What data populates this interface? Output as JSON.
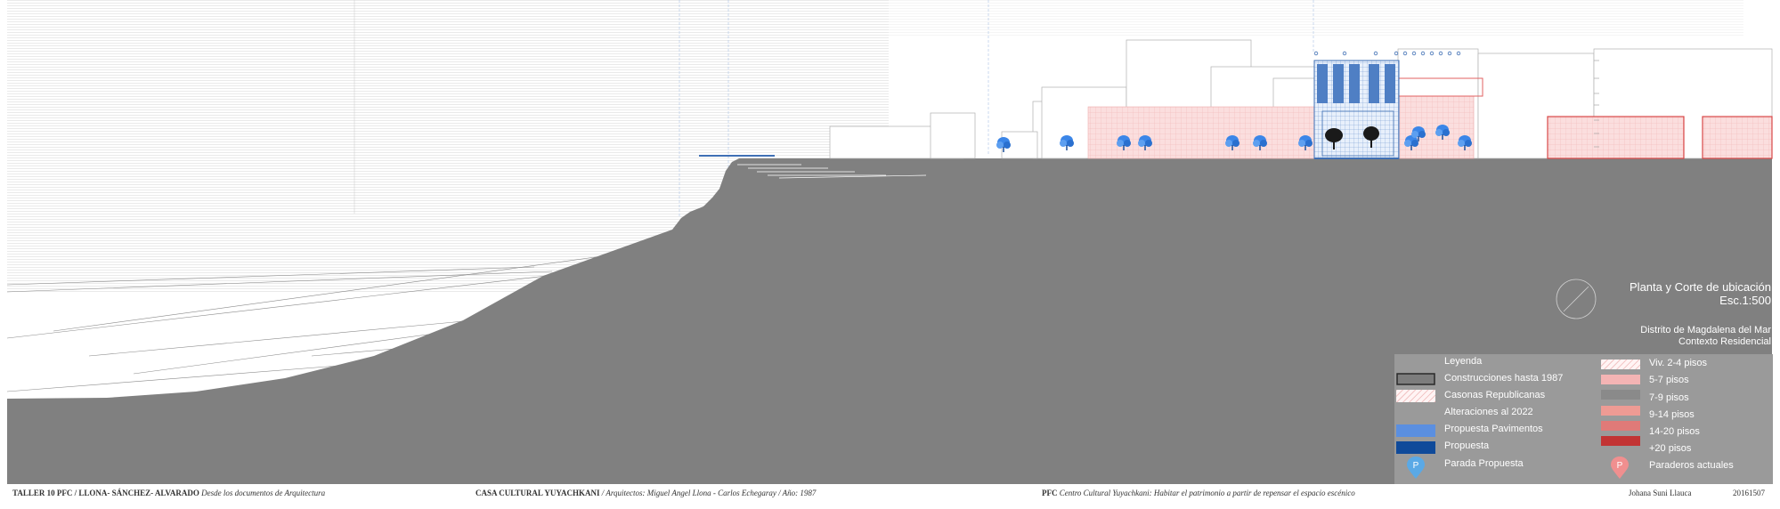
{
  "title_block": {
    "line1": "Planta y Corte de ubicación",
    "line2": "Esc.1:500",
    "line3": "Distrito de Magdalena del Mar",
    "line4": "Contexto Residencial"
  },
  "legend": {
    "heading": "Leyenda",
    "left_items": [
      {
        "label": "Construcciones hasta 1987",
        "icon": "outlined-box",
        "color": "#666666"
      },
      {
        "label": "Casonas Republicanas",
        "icon": "hatched-box",
        "color": "#f4c6c6"
      },
      {
        "label": "Alteraciones al 2022",
        "icon": "none",
        "color": ""
      },
      {
        "label": "Propuesta Pavimentos",
        "icon": "filled-box",
        "color": "#5b8fe0"
      },
      {
        "label": "Propuesta",
        "icon": "filled-box",
        "color": "#0f4a9a"
      },
      {
        "label": "Parada Propuesta",
        "icon": "parking-pin",
        "color": "#5aa9e6"
      }
    ],
    "right_items": [
      {
        "label": "Viv. 2-4 pisos",
        "icon": "hatched-box",
        "color": "#f2c0c0"
      },
      {
        "label": "5-7 pisos",
        "icon": "filled-box",
        "color": "#f4b4b4"
      },
      {
        "label": "7-9 pisos",
        "icon": "filled-box",
        "color": "#8a8a8a"
      },
      {
        "label": "9-14 pisos",
        "icon": "filled-box",
        "color": "#ee9b94"
      },
      {
        "label": "14-20 pisos",
        "icon": "filled-box",
        "color": "#e07a78"
      },
      {
        "label": "+20 pisos",
        "icon": "filled-box",
        "color": "#c23434"
      },
      {
        "label": "Paraderos actuales",
        "icon": "parking-pin",
        "color": "#f08f8f"
      }
    ],
    "parking_letter": "P"
  },
  "footer": {
    "b1": "TALLER 10 PFC / LLONA- SÁNCHEZ- ALVARADO",
    "i1": "Desde los documentos de Arquitectura",
    "b2": "CASA CULTURAL YUYACHKANI",
    "i2": "/ Arquitectos: Miguel Angel Llona - Carlos Echegaray / Año: 1987",
    "b3": "PFC",
    "i3": "Centro Cultural Yuyachkani: Habitar el patrimonio a partir de repensar el espacio escénico",
    "author": "Johana Suni Llauca",
    "code": "20161507"
  },
  "colors": {
    "ground": "#808080",
    "legend_bg": "#9a9a9a",
    "proposal_blue": "#3f6fb4",
    "tree_blue": "#3b86e8",
    "pink": "#f4c6c6",
    "red_outline": "#e06060"
  }
}
